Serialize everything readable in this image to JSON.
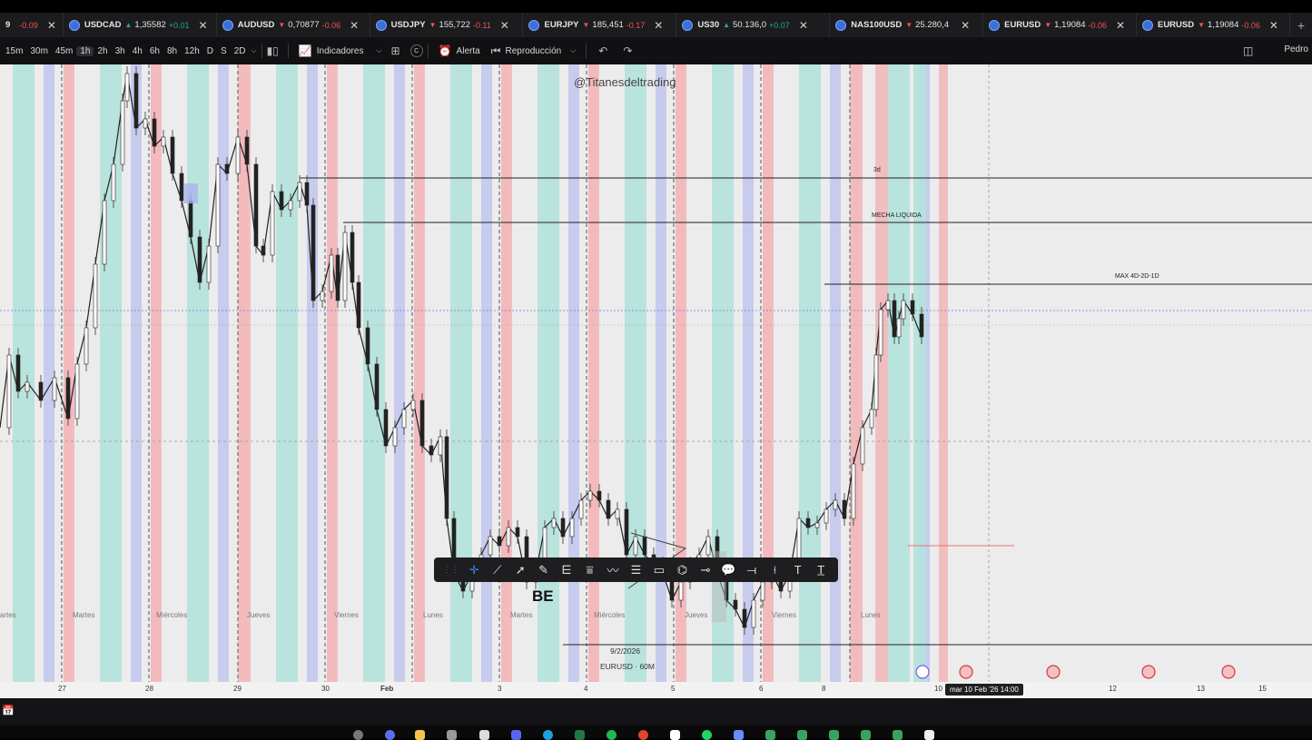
{
  "tabs": [
    {
      "symbol": "9",
      "arrow": "",
      "price": "",
      "change": "-0.09",
      "up": false
    },
    {
      "symbol": "USDCAD",
      "arrow": "▲",
      "price": "1,35582",
      "change": "+0.01",
      "up": true
    },
    {
      "symbol": "AUDUSD",
      "arrow": "▼",
      "price": "0,70877",
      "change": "-0.06",
      "up": false
    },
    {
      "symbol": "USDJPY",
      "arrow": "▼",
      "price": "155,722",
      "change": "-0.11",
      "up": false
    },
    {
      "symbol": "EURJPY",
      "arrow": "▼",
      "price": "185,451",
      "change": "-0.17",
      "up": false
    },
    {
      "symbol": "US30",
      "arrow": "▲",
      "price": "50.136,0",
      "change": "+0.07",
      "up": true
    },
    {
      "symbol": "NAS100USD",
      "arrow": "▼",
      "price": "25.280,4",
      "change": "",
      "up": false
    },
    {
      "symbol": "EURUSD",
      "arrow": "▼",
      "price": "1,19084",
      "change": "-0.06",
      "up": false
    },
    {
      "symbol": "EURUSD",
      "arrow": "▼",
      "price": "1,19084",
      "change": "-0.06",
      "up": false
    }
  ],
  "timeframes": [
    "15m",
    "30m",
    "45m",
    "1h",
    "2h",
    "3h",
    "4h",
    "6h",
    "8h",
    "12h",
    "D",
    "S",
    "2D"
  ],
  "active_timeframe": "1h",
  "toolbar": {
    "indicators": "Indicadores",
    "alert": "Alerta",
    "replay": "Reproducción",
    "user": "Pedro",
    "c_label": "C"
  },
  "watermark": "@Titanesdeltrading",
  "levels": [
    {
      "label": "3d"
    },
    {
      "label": "MECHA LIQUIDA"
    },
    {
      "label": "MAX 4D-2D-1D"
    }
  ],
  "day_names": [
    "artes",
    "Martes",
    "Miércoles",
    "Jueves",
    "Viernes",
    "Lunes",
    "Martes",
    "Miércoles",
    "Jueves",
    "Viernes",
    "Lunes"
  ],
  "be_label": "BE",
  "chart_info": {
    "date": "9/2/2026",
    "symbol": "EURUSD · 60M"
  },
  "time_ticks": [
    "27",
    "28",
    "29",
    "30",
    "Feb",
    "3",
    "4",
    "5",
    "6",
    "8",
    "10",
    "12",
    "13",
    "15"
  ],
  "cursor_time": "mar 10 Feb '26   14:00",
  "colors": {
    "red_band": "#f2b9bb",
    "teal_band": "#b4e2dc",
    "blue_band": "#c3c8ee",
    "chart_bg": "#ececec",
    "level_line": "#222222",
    "price_line": "#6c78e0"
  }
}
